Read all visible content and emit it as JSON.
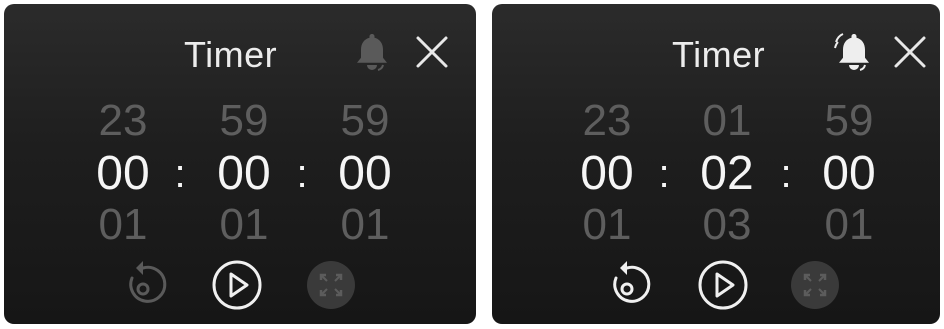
{
  "colors": {
    "background": "#1b1b1b",
    "text_active": "#f5f5f5",
    "text_inactive": "#5e5e5e",
    "icon_dim": "#6a6a6a",
    "icon_bright": "#f0f0f0"
  },
  "panels": [
    {
      "title": "Timer",
      "bell_icon": "bell-icon",
      "bell_active": false,
      "close_icon": "close-icon",
      "picker": {
        "prev": [
          "23",
          "59",
          "59"
        ],
        "current": [
          "00",
          "00",
          "00"
        ],
        "next": [
          "01",
          "01",
          "01"
        ],
        "separator": ":"
      },
      "controls": [
        {
          "icon": "reset-icon",
          "enabled": false
        },
        {
          "icon": "play-icon",
          "enabled": true
        },
        {
          "icon": "fullscreen-icon",
          "enabled": false
        }
      ]
    },
    {
      "title": "Timer",
      "bell_icon": "bell-icon",
      "bell_active": true,
      "close_icon": "close-icon",
      "picker": {
        "prev": [
          "23",
          "01",
          "59"
        ],
        "current": [
          "00",
          "02",
          "00"
        ],
        "next": [
          "01",
          "03",
          "01"
        ],
        "separator": ":"
      },
      "controls": [
        {
          "icon": "reset-icon",
          "enabled": true
        },
        {
          "icon": "play-icon",
          "enabled": true
        },
        {
          "icon": "fullscreen-icon",
          "enabled": false
        }
      ]
    }
  ]
}
